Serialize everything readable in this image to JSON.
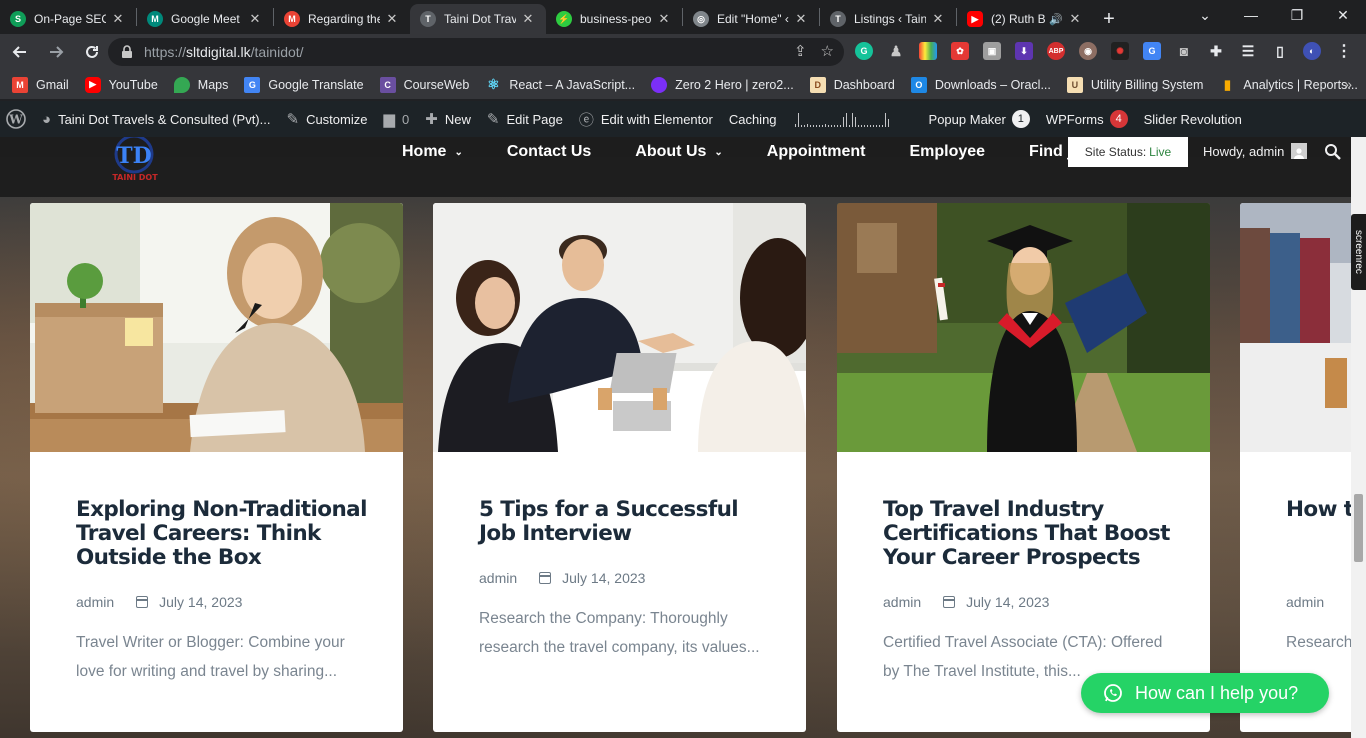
{
  "tabs": [
    {
      "label": "On-Page SEO",
      "color": "#0f9d58",
      "glyph": "S"
    },
    {
      "label": "Google Meet",
      "color": "#00897b",
      "glyph": "M"
    },
    {
      "label": "Regarding the",
      "color": "#ea4335",
      "glyph": "M"
    },
    {
      "label": "Taini Dot Trav",
      "color": "#5f6368",
      "glyph": "T"
    },
    {
      "label": "business-peo",
      "color": "#2ecc40",
      "glyph": "⚡"
    },
    {
      "label": "Edit \"Home\" ‹",
      "color": "#80868b",
      "glyph": "◎"
    },
    {
      "label": "Listings ‹ Tain",
      "color": "#5f6368",
      "glyph": "T"
    },
    {
      "label": "(2) Ruth B",
      "color": "#ff0000",
      "glyph": "▶"
    }
  ],
  "close_glyph": "✕",
  "new_tab_glyph": "+",
  "window": {
    "min": "—",
    "max": "❐",
    "close": "✕",
    "dropdown": "⌄"
  },
  "address": {
    "scheme": "https://",
    "host": "sltdigital.lk",
    "path": "/tainidot/"
  },
  "bookmarks": [
    {
      "label": "Gmail",
      "color": "#ea4335",
      "glyph": "M"
    },
    {
      "label": "YouTube",
      "color": "#ff0000",
      "glyph": "▶"
    },
    {
      "label": "Maps",
      "color": "#34a853",
      "glyph": "●"
    },
    {
      "label": "Google Translate",
      "color": "#4285f4",
      "glyph": "G"
    },
    {
      "label": "CourseWeb",
      "color": "#6a4fa0",
      "glyph": "C"
    },
    {
      "label": "React – A JavaScript...",
      "color": "#61dafb",
      "glyph": "⚛"
    },
    {
      "label": "Zero 2 Hero | zero2...",
      "color": "#7b2ff7",
      "glyph": "●"
    },
    {
      "label": "Dashboard",
      "color": "#8a4b1f",
      "glyph": "D"
    },
    {
      "label": "Downloads – Oracl...",
      "color": "#1e88e5",
      "glyph": "O"
    },
    {
      "label": "Utility Billing System",
      "color": "#9e7b4f",
      "glyph": "U"
    },
    {
      "label": "Analytics | Reports...",
      "color": "#f9ab00",
      "glyph": "▮"
    }
  ],
  "bookmarks_more": "»",
  "admin_bar": {
    "site": "Taini Dot Travels & Consulted (Pvt)...",
    "customize": "Customize",
    "comments": "0",
    "new": "New",
    "edit_page": "Edit Page",
    "elementor": "Edit with Elementor",
    "caching": "Caching",
    "popup_maker": "Popup Maker",
    "popup_count": "1",
    "wpforms": "WPForms",
    "wpforms_count": "4",
    "slider": "Slider Revolution"
  },
  "site": {
    "nav": [
      {
        "label": "Home",
        "has_dropdown": true
      },
      {
        "label": "Contact Us",
        "has_dropdown": false
      },
      {
        "label": "About Us",
        "has_dropdown": true
      },
      {
        "label": "Appointment",
        "has_dropdown": false
      },
      {
        "label": "Employee",
        "has_dropdown": false
      },
      {
        "label": "Find jobs",
        "has_dropdown": false
      }
    ],
    "logo_text": "TAINI DOT",
    "status_label": "Site Status:",
    "status_value": "Live",
    "howdy": "Howdy, admin"
  },
  "posts": [
    {
      "title": "Exploring Non-Traditional Travel Careers: Think Outside the Box",
      "author": "admin",
      "date": "July 14, 2023",
      "excerpt": "Travel Writer or Blogger: Combine your love for writing and travel by sharing..."
    },
    {
      "title": "5 Tips for a Successful Job Interview",
      "author": "admin",
      "date": "July 14, 2023",
      "excerpt": "Research the Company: Thoroughly research the travel company, its values..."
    },
    {
      "title": "Top Travel Industry Certifications That Boost Your Career Prospects",
      "author": "admin",
      "date": "July 14, 2023",
      "excerpt": "Certified Travel Associate (CTA): Offered by The Travel Institute, this..."
    },
    {
      "title": "How t Abroa Guide",
      "author": "admin",
      "date": "",
      "excerpt": "Research Underst"
    }
  ],
  "chat_button": "How can I help you?",
  "screenrec_label": "screenrec"
}
